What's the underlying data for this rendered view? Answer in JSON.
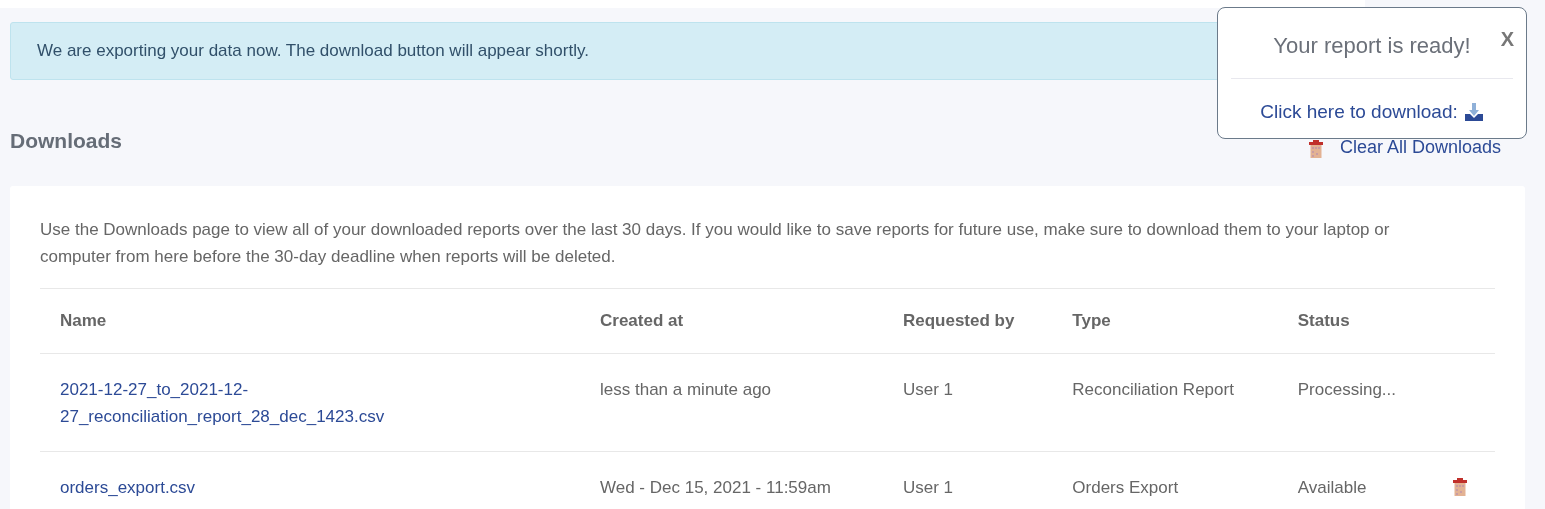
{
  "alert": {
    "text": "We are exporting your data now. The download button will appear shortly."
  },
  "heading": "Downloads",
  "clear_all": {
    "label": "Clear All Downloads"
  },
  "description": "Use the Downloads page to view all of your downloaded reports over the last 30 days. If you would like to save reports for future use, make sure to download them to your laptop or computer from here before the 30-day deadline when reports will be deleted.",
  "table": {
    "columns": [
      "Name",
      "Created at",
      "Requested by",
      "Type",
      "Status"
    ],
    "rows": [
      {
        "name": "2021-12-27_to_2021-12-27_reconciliation_report_28_dec_1423.csv",
        "created_at": "less than a minute ago",
        "requested_by": "User 1",
        "type": "Reconciliation Report",
        "status": "Processing...",
        "deletable": false
      },
      {
        "name": "orders_export.csv",
        "created_at": "Wed - Dec 15, 2021 - 11:59am",
        "requested_by": "User 1",
        "type": "Orders Export",
        "status": "Available",
        "deletable": true
      }
    ]
  },
  "popup": {
    "title": "Your report is ready!",
    "close": "X",
    "link": "Click here to download:"
  }
}
